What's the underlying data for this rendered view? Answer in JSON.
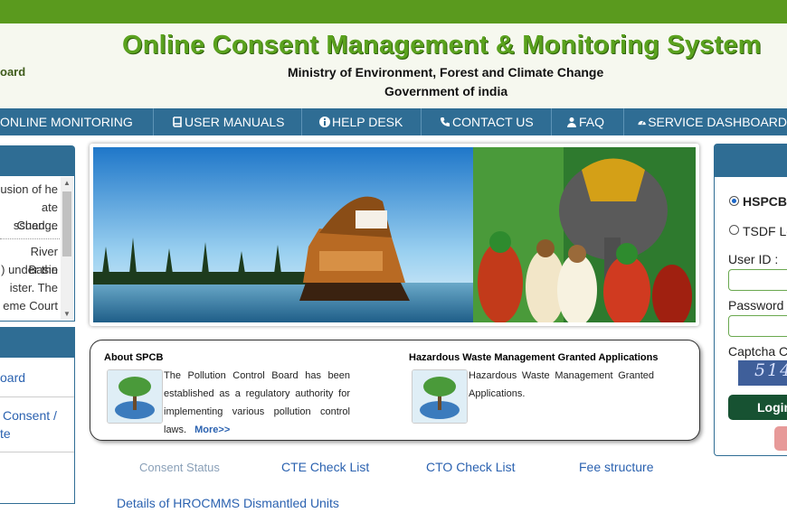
{
  "header": {
    "board_fragment": "oard",
    "title": "Online Consent Management & Monitoring System",
    "ministry": "Ministry of Environment, Forest and Climate Change",
    "government": "Government of india"
  },
  "nav": {
    "items": [
      {
        "label": "ONLINE MONITORING",
        "icon": "none"
      },
      {
        "label": "USER MANUALS",
        "icon": "book-icon"
      },
      {
        "label": "HELP DESK",
        "icon": "info-circle-icon"
      },
      {
        "label": "CONTACT US",
        "icon": "phone-icon"
      },
      {
        "label": "FAQ",
        "icon": "users-icon"
      },
      {
        "label": "SERVICE DASHBOARD",
        "icon": "dashboard-icon"
      }
    ]
  },
  "left_panel": {
    "news_lines": [
      "usion of he",
      "ate Change",
      "ssued....",
      "River Basin",
      ") under the",
      "ister.   The",
      "eme Court",
      "      ."
    ],
    "links": [
      "oard",
      "Consent    /",
      "te"
    ]
  },
  "about": {
    "title": "About SPCB",
    "text": "The Pollution Control Board has been established as a regulatory authority for implementing various pollution control laws.",
    "more": "More>>"
  },
  "hazardous": {
    "title": "Hazardous Waste Management Granted Applications",
    "text": "Hazardous Waste Management Granted Applications."
  },
  "links": {
    "consent_status": "Consent Status",
    "cte": "CTE Check List",
    "cto": "CTO Check List",
    "fee": "Fee structure",
    "hrocmms": "Details of HROCMMS Dismantled Units"
  },
  "login": {
    "radio1": "HSPCB",
    "radio2": "TSDF Lo",
    "user_label": "User ID :",
    "password_label": "Password :",
    "captcha_label": "Captcha Co",
    "captcha_value": "514",
    "button": "Login",
    "selected": "HSPCB"
  },
  "colors": {
    "topbar": "#5a9a1e",
    "nav": "#2f6d94",
    "title": "#5aa21e",
    "link": "#2b62b0",
    "login_button": "#175232"
  }
}
